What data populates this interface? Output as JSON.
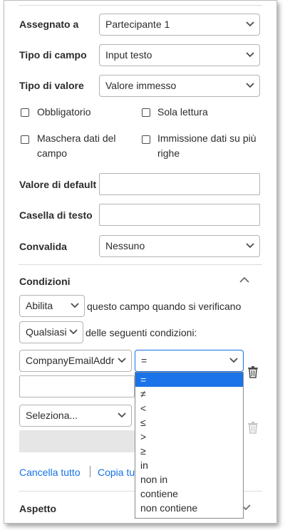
{
  "fields": {
    "assigned_to": {
      "label": "Assegnato a",
      "value": "Partecipante 1"
    },
    "field_type": {
      "label": "Tipo di campo",
      "value": "Input testo"
    },
    "value_type": {
      "label": "Tipo di valore",
      "value": "Valore immesso"
    },
    "checkboxes": {
      "required": "Obbligatorio",
      "read_only": "Sola lettura",
      "mask_line1": "Maschera dati del",
      "mask_line2": "campo",
      "multiline_line1": "Immissione dati su più",
      "multiline_line2": "righe"
    },
    "default_value": {
      "label": "Valore di default",
      "value": ""
    },
    "tooltip": {
      "label": "Casella di testo",
      "value": ""
    },
    "validate": {
      "label": "Convalida",
      "value": "Nessuno"
    }
  },
  "conditions": {
    "title": "Condizioni",
    "action_value": "Abilita",
    "action_text": "questo campo quando si verificano",
    "match_value": "Qualsiasi",
    "match_text": "delle seguenti condizioni:",
    "field_value": "CompanyEmailAddr",
    "operator_value": "=",
    "second_select_value": "Seleziona...",
    "operator_options": [
      "=",
      "≠",
      "<",
      "≤",
      ">",
      "≥",
      "in",
      "non in",
      "contiene",
      "non contiene"
    ],
    "clear_all": "Cancella tutto",
    "copy_all": "Copia tu"
  },
  "appearance": {
    "title": "Aspetto"
  },
  "colors": {
    "accent": "#1473e6",
    "selected_option": "#1a73e8"
  }
}
